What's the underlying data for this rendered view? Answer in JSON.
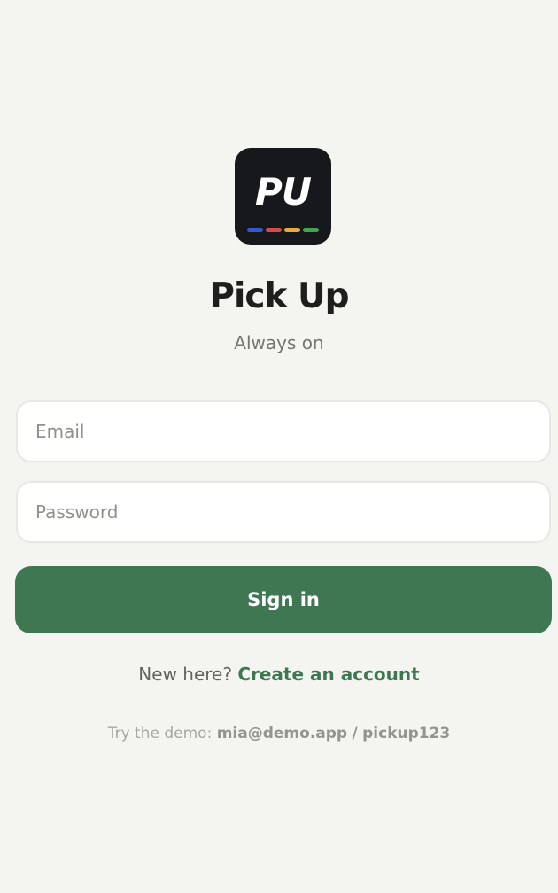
{
  "app": {
    "icon_text": "PU",
    "name": "Pick Up",
    "tagline": "Always on"
  },
  "icon_dots": [
    "#2f5ad6",
    "#d94a44",
    "#e8aa3c",
    "#3ea84c"
  ],
  "form": {
    "email_placeholder": "Email",
    "email_value": "",
    "password_placeholder": "Password",
    "password_value": "",
    "sign_in_label": "Sign in"
  },
  "signup": {
    "prompt": "New here?",
    "link_label": "Create an account"
  },
  "demo": {
    "prefix": "Try the demo:",
    "email": "mia@demo.app",
    "separator": "/",
    "password": "pickup123"
  },
  "colors": {
    "background": "#f4f4f1",
    "accent": "#3e7751",
    "icon_background": "#16181b"
  }
}
